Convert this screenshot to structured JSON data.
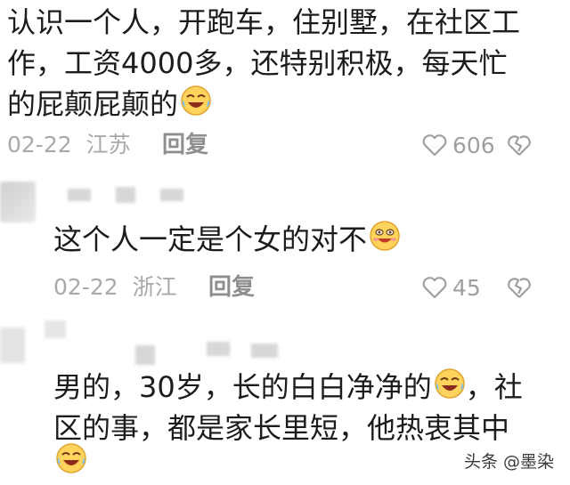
{
  "comments": [
    {
      "lines": [
        "认识一个人，开跑车，住别墅，在社区工",
        "作，工资4000多，还特别积极，每天忙",
        "的屁颠屁颠的"
      ],
      "date": "02-22",
      "location": "江苏",
      "reply_label": "回复",
      "likes": "606"
    },
    {
      "lines": [
        "这个人一定是个女的对不"
      ],
      "date": "02-22",
      "location": "浙江",
      "reply_label": "回复",
      "likes": "45"
    },
    {
      "lines": [
        "男的，30岁，长的白白净净的",
        "，社",
        "区的事，都是家长里短，他热衷其中"
      ]
    }
  ],
  "icons": {
    "like": "heart-outline-icon",
    "dislike": "broken-heart-icon",
    "emoji_laugh": "laughing-crying-emoji-icon",
    "emoji_smile": "smiling-emoji-icon"
  },
  "watermark": "头条 @墨染"
}
